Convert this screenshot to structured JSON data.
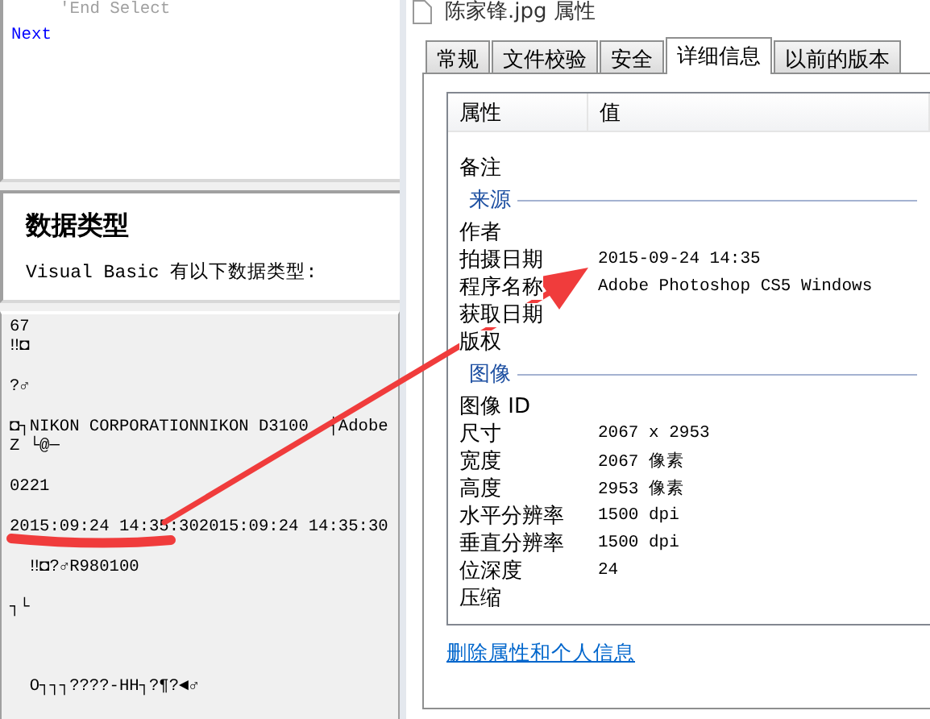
{
  "code_pane": {
    "lines": [
      {
        "kind": "comment",
        "text": "'End Select"
      },
      {
        "kind": "keyword",
        "text": "Next"
      }
    ]
  },
  "doc_pane": {
    "heading": "数据类型",
    "intro": "Visual Basic 有以下数据类型:"
  },
  "binary_pane": {
    "paragraphs": [
      [
        "67",
        "‼◘"
      ],
      [
        "?♂"
      ],
      [
        "◘┐NIKON CORPORATIONNIKON D3100  ┤Adobe",
        "Z └@─"
      ],
      [
        "0221"
      ],
      [
        "2015:09:24 14:35:302015:09:24 14:35:30"
      ],
      [
        "  ‼◘?♂R980100"
      ],
      [
        "┐└"
      ],
      [
        "  O┐┐┐????-HH┐?¶?◄♂"
      ]
    ]
  },
  "dialog": {
    "title": "陈家锋.jpg 属性",
    "tabs": [
      {
        "label": "常规",
        "selected": false
      },
      {
        "label": "文件校验",
        "selected": false
      },
      {
        "label": "安全",
        "selected": false
      },
      {
        "label": "详细信息",
        "selected": true
      },
      {
        "label": "以前的版本",
        "selected": false
      }
    ],
    "columns": [
      "属性",
      "值"
    ],
    "rows": [
      {
        "kind": "row",
        "label": "备注"
      },
      {
        "kind": "group",
        "label": "来源"
      },
      {
        "kind": "row",
        "label": "作者"
      },
      {
        "kind": "row",
        "label": "拍摄日期",
        "value": "2015-09-24 14:35"
      },
      {
        "kind": "row",
        "label": "程序名称",
        "value": "Adobe Photoshop CS5 Windows"
      },
      {
        "kind": "row",
        "label": "获取日期"
      },
      {
        "kind": "row",
        "label": "版权"
      },
      {
        "kind": "group",
        "label": "图像"
      },
      {
        "kind": "row",
        "label": "图像 ID"
      },
      {
        "kind": "row",
        "label": "尺寸",
        "value": "2067 x 2953"
      },
      {
        "kind": "row",
        "label": "宽度",
        "value": "2067 像素"
      },
      {
        "kind": "row",
        "label": "高度",
        "value": "2953 像素"
      },
      {
        "kind": "row",
        "label": "水平分辨率",
        "value": "1500 dpi"
      },
      {
        "kind": "row",
        "label": "垂直分辨率",
        "value": "1500 dpi"
      },
      {
        "kind": "row",
        "label": "位深度",
        "value": "24"
      },
      {
        "kind": "row",
        "label": "压缩"
      }
    ],
    "link": "删除属性和个人信息"
  }
}
